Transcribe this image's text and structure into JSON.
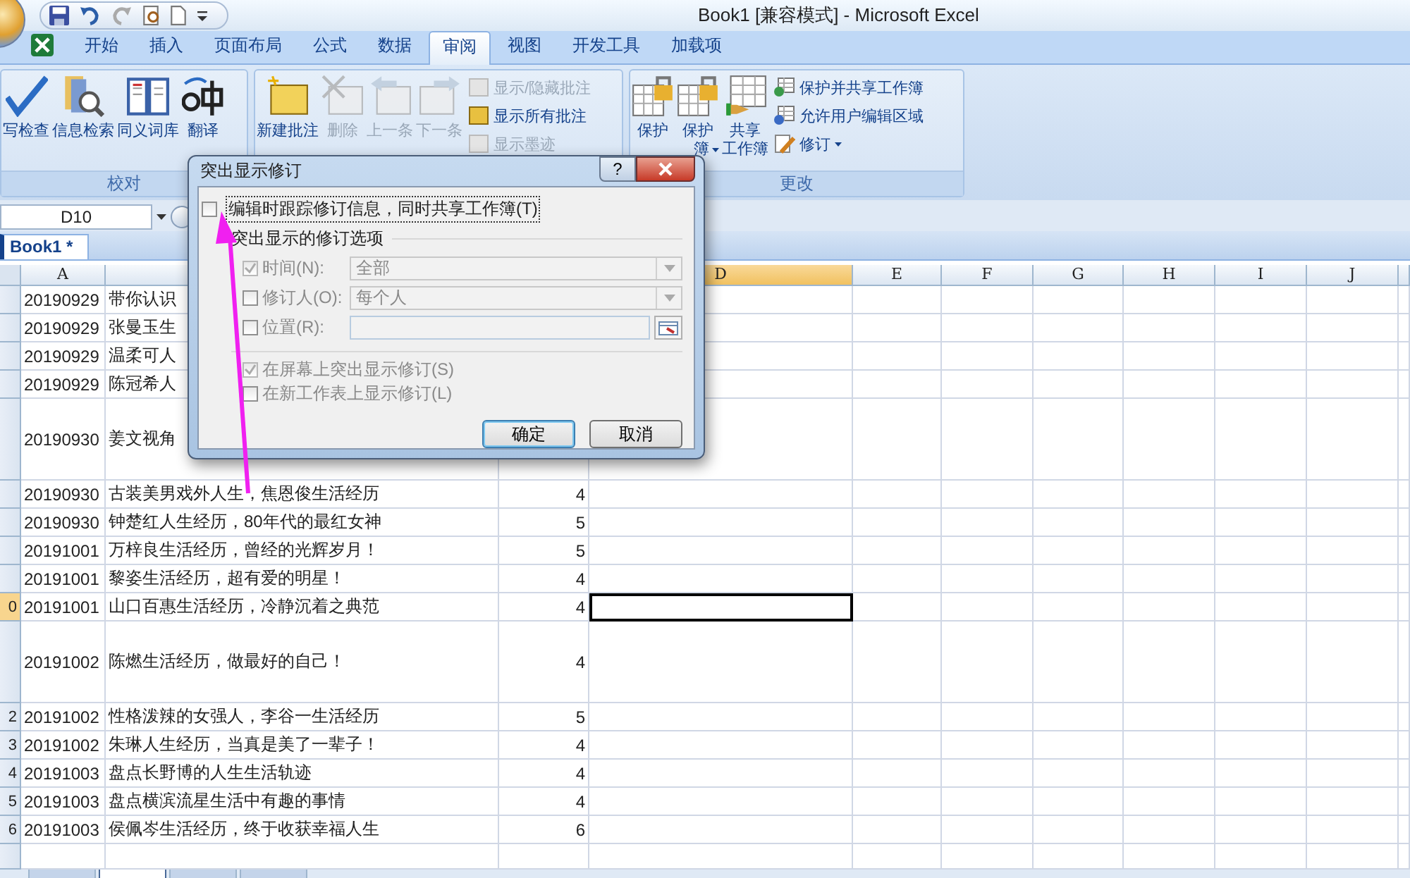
{
  "window": {
    "title": "Book1  [兼容模式] - Microsoft Excel"
  },
  "ribbon_tabs": [
    {
      "label": "开始",
      "selected": false
    },
    {
      "label": "插入",
      "selected": false
    },
    {
      "label": "页面布局",
      "selected": false
    },
    {
      "label": "公式",
      "selected": false
    },
    {
      "label": "数据",
      "selected": false
    },
    {
      "label": "审阅",
      "selected": true
    },
    {
      "label": "视图",
      "selected": false
    },
    {
      "label": "开发工具",
      "selected": false
    },
    {
      "label": "加载项",
      "selected": false
    }
  ],
  "ribbon_groups": [
    {
      "label": "校对",
      "buttons": [
        {
          "kind": "big",
          "label": "写检查",
          "disabled": false
        },
        {
          "kind": "big",
          "label": "信息检索",
          "disabled": false
        },
        {
          "kind": "big",
          "label": "同义词库",
          "disabled": false
        },
        {
          "kind": "big",
          "label": "翻译",
          "disabled": false
        }
      ]
    },
    {
      "buttons": [
        {
          "kind": "big",
          "label": "新建批注",
          "disabled": false
        },
        {
          "kind": "big",
          "label": "删除",
          "disabled": true
        },
        {
          "kind": "big",
          "label": "上一条",
          "disabled": true
        },
        {
          "kind": "big",
          "label": "下一条",
          "disabled": true
        },
        {
          "kind": "small",
          "label": "显示/隐藏批注",
          "disabled": true
        },
        {
          "kind": "small",
          "label": "显示所有批注",
          "disabled": false
        },
        {
          "kind": "small",
          "label": "显示墨迹",
          "disabled": true
        }
      ]
    },
    {
      "label": "更改",
      "buttons": [
        {
          "kind": "big",
          "label": "保护",
          "disabled": false
        },
        {
          "kind": "big",
          "label": "保护",
          "label2": "簿",
          "dropdown": true,
          "disabled": false
        },
        {
          "kind": "big",
          "label": "共享",
          "label2": "工作簿",
          "dropdown": false,
          "disabled": false
        },
        {
          "kind": "small",
          "label": "保护并共享工作簿",
          "dropdown": false,
          "disabled": false
        },
        {
          "kind": "small",
          "label": "允许用户编辑区域",
          "dropdown": false,
          "disabled": false
        },
        {
          "kind": "small",
          "label": "修订",
          "dropdown": true,
          "disabled": false
        }
      ]
    }
  ],
  "name_box": "D10",
  "workbook_tab": "Book1 *",
  "columns": [
    {
      "label": "A",
      "selected": false
    },
    {
      "selected": false
    },
    {
      "label": "D",
      "selected": true
    },
    {
      "label": "E",
      "selected": false
    },
    {
      "label": "F",
      "selected": false
    },
    {
      "label": "G",
      "selected": false
    },
    {
      "label": "H",
      "selected": false
    },
    {
      "label": "I",
      "selected": false
    },
    {
      "label": "J",
      "selected": false
    }
  ],
  "rows": [
    {
      "kind": "normal",
      "selected": false,
      "a": "20190929",
      "b": "带你认识"
    },
    {
      "kind": "normal",
      "selected": false,
      "a": "20190929",
      "b": "张曼玉生"
    },
    {
      "kind": "normal",
      "selected": false,
      "a": "20190929",
      "b": "温柔可人"
    },
    {
      "kind": "normal",
      "selected": false,
      "a": "20190929",
      "b": "陈冠希人"
    },
    {
      "kind": "tall",
      "selected": false,
      "a": "20190930",
      "b": "姜文视角"
    },
    {
      "kind": "normal",
      "selected": false,
      "a": "20190930",
      "b": "古装美男戏外人生，焦恩俊生活经历",
      "c": "4"
    },
    {
      "kind": "normal",
      "selected": false,
      "a": "20190930",
      "b": "钟楚红人生经历，80年代的最红女神",
      "c": "5"
    },
    {
      "kind": "normal",
      "selected": false,
      "a": "20191001",
      "b": "万梓良生活经历，曾经的光辉岁月！",
      "c": "5"
    },
    {
      "kind": "normal",
      "selected": false,
      "a": "20191001",
      "b": "黎姿生活经历，超有爱的明星！",
      "c": "4"
    },
    {
      "kind": "normal",
      "selected": true,
      "header": "0",
      "a": "20191001",
      "b": "山口百惠生活经历，冷静沉着之典范",
      "c": "4"
    },
    {
      "kind": "tall",
      "selected": false,
      "a": "20191002",
      "b": "陈燃生活经历，做最好的自己！",
      "c": "4"
    },
    {
      "kind": "normal",
      "selected": false,
      "header": "2",
      "a": "20191002",
      "b": "性格泼辣的女强人，李谷一生活经历",
      "c": "5"
    },
    {
      "kind": "normal",
      "selected": false,
      "header": "3",
      "a": "20191002",
      "b": "朱琳人生经历，当真是美了一辈子！",
      "c": "4"
    },
    {
      "kind": "normal",
      "selected": false,
      "header": "4",
      "a": "20191003",
      "b": "盘点长野博的人生生活轨迹",
      "c": "4"
    },
    {
      "kind": "normal",
      "selected": false,
      "header": "5",
      "a": "20191003",
      "b": "盘点横滨流星生活中有趣的事情",
      "c": "4"
    },
    {
      "kind": "normal",
      "selected": false,
      "header": "6",
      "a": "20191003",
      "b": "侯佩岑生活经历，终于收获幸福人生",
      "c": "6"
    }
  ],
  "sheet_tabs": [
    {
      "selected": false
    },
    {
      "selected": true
    },
    {
      "selected": false
    },
    {
      "selected": false
    }
  ],
  "dialog": {
    "title": "突出显示修订",
    "help_button": "?",
    "share_checkbox": {
      "label": "编辑时跟踪修订信息，同时共享工作簿(T)",
      "checked": false,
      "focused": true
    },
    "group_label": "突出显示的修订选项",
    "filters": [
      {
        "kind": "dropdown",
        "label": "时间(N):",
        "checked": true,
        "disabled": true,
        "value": "全部"
      },
      {
        "kind": "dropdown",
        "label": "修订人(O):",
        "checked": false,
        "disabled": true,
        "value": "每个人"
      },
      {
        "kind": "range",
        "label": "位置(R):",
        "checked": false,
        "disabled": true
      }
    ],
    "options": [
      {
        "label": "在屏幕上突出显示修订(S)",
        "checked": true,
        "disabled": true
      },
      {
        "label": "在新工作表上显示修订(L)",
        "checked": false,
        "disabled": true
      }
    ],
    "buttons": [
      {
        "label": "确定",
        "default": true
      },
      {
        "label": "取消",
        "default": false
      }
    ]
  }
}
